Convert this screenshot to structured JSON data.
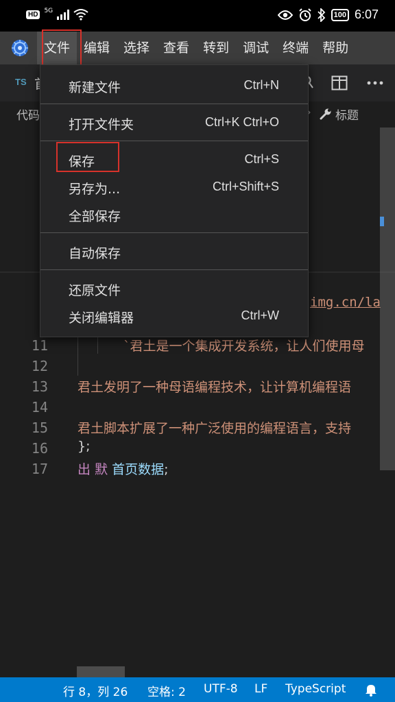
{
  "status_bar": {
    "hd": "HD",
    "signal": "5G",
    "battery": "100",
    "time": "6:07"
  },
  "menu_bar": {
    "items": [
      "文件",
      "编辑",
      "选择",
      "查看",
      "转到",
      "调试",
      "终端",
      "帮助"
    ]
  },
  "tab": {
    "lang": "TS",
    "name": "首"
  },
  "breadcrumb": {
    "left": "代码",
    "right": "标题"
  },
  "editor": {
    "url_fragment": "img.cn/la",
    "lines": [
      {
        "num": "1",
        "segments": []
      },
      {
        "num": "11",
        "segments": [
          {
            "cls": "str",
            "text": "`君土是一个集成开发系统，让人们使用母"
          }
        ]
      },
      {
        "num": "12",
        "segments": []
      },
      {
        "num": "13",
        "segments": [
          {
            "cls": "str",
            "text": "君土发明了一种母语编程技术，让计算机编程语"
          }
        ]
      },
      {
        "num": "14",
        "segments": []
      },
      {
        "num": "15",
        "segments": [
          {
            "cls": "str",
            "text": "君土脚本扩展了一种广泛使用的编程语言，支持"
          }
        ]
      },
      {
        "num": "16",
        "segments": [
          {
            "cls": "plain",
            "text": "};"
          }
        ]
      },
      {
        "num": "17",
        "segments": [
          {
            "cls": "kw",
            "text": "出"
          },
          {
            "cls": "plain",
            "text": " "
          },
          {
            "cls": "kw",
            "text": "默"
          },
          {
            "cls": "plain",
            "text": " "
          },
          {
            "cls": "ident",
            "text": "首页数据"
          },
          {
            "cls": "plain",
            "text": ";"
          }
        ]
      }
    ]
  },
  "file_menu": {
    "new_file": {
      "label": "新建文件",
      "shortcut": "Ctrl+N"
    },
    "open_folder": {
      "label": "打开文件夹",
      "shortcut": "Ctrl+K Ctrl+O"
    },
    "save": {
      "label": "保存",
      "shortcut": "Ctrl+S"
    },
    "save_as": {
      "label": "另存为...",
      "shortcut": "Ctrl+Shift+S"
    },
    "save_all": {
      "label": "全部保存",
      "shortcut": ""
    },
    "auto_save": {
      "label": "自动保存",
      "shortcut": ""
    },
    "revert_file": {
      "label": "还原文件",
      "shortcut": ""
    },
    "close_editor": {
      "label": "关闭编辑器",
      "shortcut": "Ctrl+W"
    }
  },
  "bottom_status": {
    "position": "行 8，列 26",
    "spaces": "空格: 2",
    "encoding": "UTF-8",
    "eol": "LF",
    "language": "TypeScript"
  },
  "colors": {
    "accent": "#007acc",
    "highlight_box": "#d7322b"
  }
}
